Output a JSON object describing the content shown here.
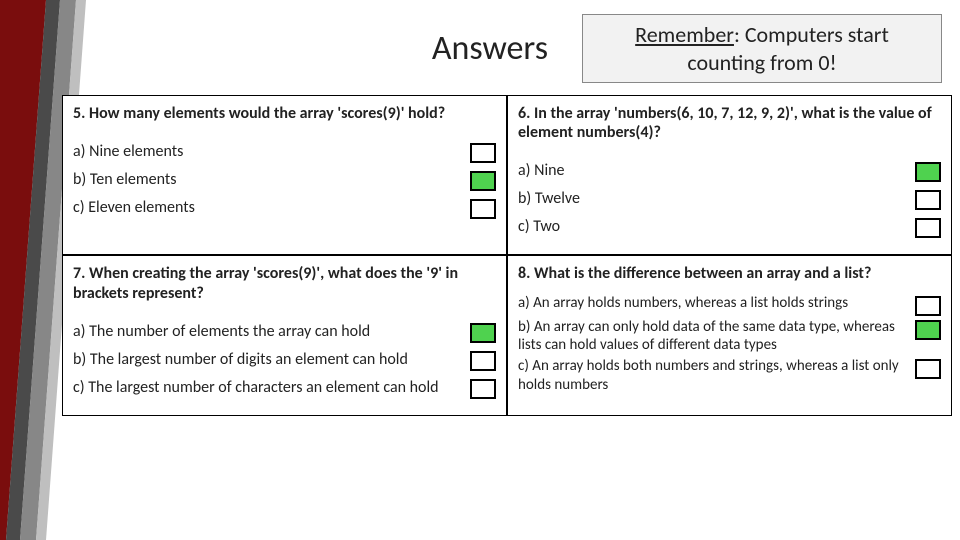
{
  "title": "Answers",
  "remember": {
    "label": "Remember",
    "rest": ": Computers start counting from 0!"
  },
  "questions": [
    {
      "q": "5. How many elements would the array 'scores(9)' hold?",
      "options": [
        {
          "text": "a) Nine elements",
          "correct": false
        },
        {
          "text": "b) Ten elements",
          "correct": true
        },
        {
          "text": "c) Eleven elements",
          "correct": false
        }
      ]
    },
    {
      "q": "6. In the array 'numbers(6, 10, 7, 12, 9, 2)', what is the value of element numbers(4)?",
      "options": [
        {
          "text": "a) Nine",
          "correct": true
        },
        {
          "text": "b) Twelve",
          "correct": false
        },
        {
          "text": "c) Two",
          "correct": false
        }
      ]
    },
    {
      "q": "7. When creating the array 'scores(9)', what does the '9' in brackets represent?",
      "options": [
        {
          "text": "a) The number of elements the array can hold",
          "correct": true
        },
        {
          "text": "b) The largest number of digits an element can hold",
          "correct": false
        },
        {
          "text": "c) The largest number of characters an element can hold",
          "correct": false
        }
      ]
    },
    {
      "q": "8. What is the difference between an array and a list?",
      "options": [
        {
          "text": "a) An array holds numbers, whereas a list holds strings",
          "correct": false
        },
        {
          "text": "b) An array can only hold data of the same data type, whereas lists can hold values of different data types",
          "correct": true
        },
        {
          "text": "c) An array holds both numbers and strings, whereas a list only holds numbers",
          "correct": false
        }
      ]
    }
  ]
}
